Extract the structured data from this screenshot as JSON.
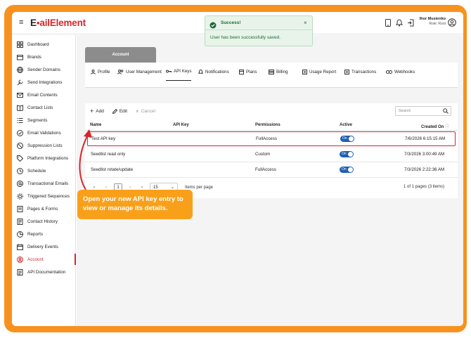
{
  "brand": {
    "logo_prefix": "E",
    "logo_mid": "▪",
    "logo_rest": "ailElement"
  },
  "user": {
    "name": "Ihor Musienko",
    "role": "Role: Root"
  },
  "toast": {
    "title": "Success!",
    "message": "User has been successfully saved."
  },
  "sidebar": {
    "items": [
      {
        "label": "Dashboard",
        "icon": "grid-icon"
      },
      {
        "label": "Brands",
        "icon": "folder-icon"
      },
      {
        "label": "Sender Domains",
        "icon": "globe-icon"
      },
      {
        "label": "Send Integrations",
        "icon": "wrench-icon"
      },
      {
        "label": "Email Contents",
        "icon": "envelope-icon"
      },
      {
        "label": "Contact Lists",
        "icon": "book-icon"
      },
      {
        "label": "Segments",
        "icon": "segments-icon"
      },
      {
        "label": "Email Validations",
        "icon": "check-circle-icon"
      },
      {
        "label": "Suppression Lists",
        "icon": "ban-icon"
      },
      {
        "label": "Platform Integrations",
        "icon": "tag-icon"
      },
      {
        "label": "Schedule",
        "icon": "clock-icon"
      },
      {
        "label": "Transactional Emails",
        "icon": "at-icon"
      },
      {
        "label": "Triggered Sequences",
        "icon": "cog-icon"
      },
      {
        "label": "Pages & Forms",
        "icon": "pages-icon"
      },
      {
        "label": "Contact History",
        "icon": "history-icon"
      },
      {
        "label": "Reports",
        "icon": "reports-icon"
      },
      {
        "label": "Delivery Events",
        "icon": "events-icon"
      },
      {
        "label": "Account",
        "icon": "account-icon"
      },
      {
        "label": "API Documentation",
        "icon": "api-doc-icon"
      }
    ]
  },
  "account_tab": "Account",
  "subnav": {
    "tabs": [
      {
        "label": "Profile"
      },
      {
        "label": "User Management"
      },
      {
        "label": "API Keys"
      },
      {
        "label": "Notifications"
      },
      {
        "label": "Plans"
      },
      {
        "label": "Billing"
      },
      {
        "label": "Usage Report"
      },
      {
        "label": "Transactions"
      },
      {
        "label": "Webhooks"
      }
    ]
  },
  "toolbar": {
    "add": "Add",
    "edit": "Edit",
    "cancel": "Cancel"
  },
  "search": {
    "placeholder": "Search"
  },
  "table": {
    "headers": {
      "name": "Name",
      "api_key": "API Key",
      "permissions": "Permissions",
      "active": "Active",
      "created_on": "Created On"
    },
    "rows": [
      {
        "name": "Test API key",
        "api_key": "",
        "permissions": "FullAccess",
        "active": "On",
        "created_on": "7/6/2026 6:15:15 AM"
      },
      {
        "name": "Seedlist read only",
        "api_key": "",
        "permissions": "Custom",
        "active": "On",
        "created_on": "7/3/2026 3:00:49 AM"
      },
      {
        "name": "Seedlist rotate/update",
        "api_key": "",
        "permissions": "FullAccess",
        "active": "On",
        "created_on": "7/3/2026 2:22:36 AM"
      }
    ]
  },
  "pager": {
    "first": "«",
    "prev": "‹",
    "current": "1",
    "next": "›",
    "last": "»",
    "page_size": "15",
    "items_per_page": "Items per page",
    "info": "1 of 1 pages (3 items)"
  },
  "callout": {
    "text": "Open your new API key entry to view or manage its details."
  },
  "colors": {
    "frame": "#f7921e",
    "accent": "#d6262c",
    "toggle": "#1f5fb4",
    "callout": "#f9a01b",
    "success": "#1a6b33"
  }
}
